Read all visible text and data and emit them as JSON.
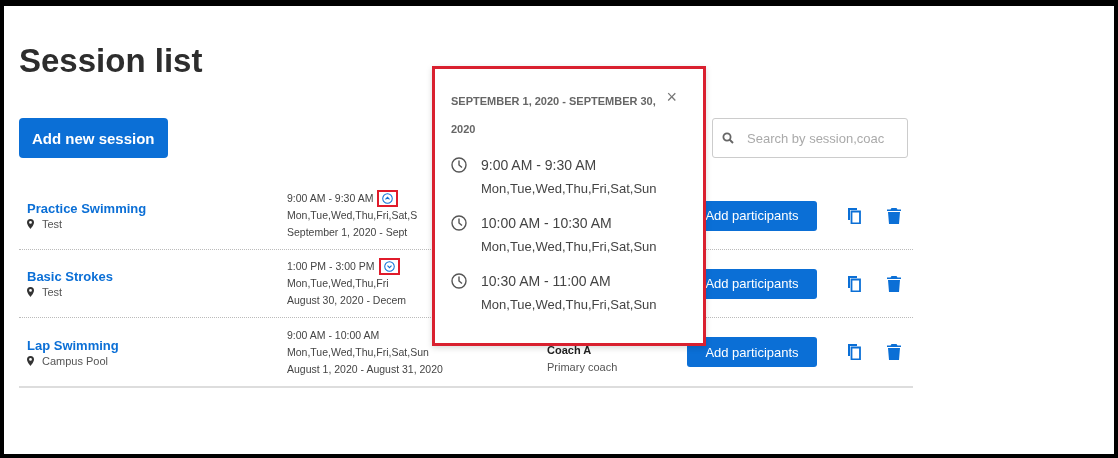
{
  "page": {
    "title": "Session list"
  },
  "add_button": "Add new session",
  "search": {
    "placeholder": "Search by session,coac"
  },
  "sessions": [
    {
      "name": "Practice Swimming",
      "location": "Test",
      "time": "9:00 AM - 9:30 AM",
      "days": "Mon,Tue,Wed,Thu,Fri,Sat,S",
      "dates": "September 1, 2020 - Sept",
      "toggle": {
        "expanded": true,
        "highlighted": true
      },
      "action": "Add participants"
    },
    {
      "name": "Basic Strokes",
      "location": "Test",
      "time": "1:00 PM - 3:00 PM",
      "days": "Mon,Tue,Wed,Thu,Fri",
      "dates": "August 30, 2020 - Decem",
      "toggle": {
        "expanded": false,
        "highlighted": true
      },
      "action": "Add participants"
    },
    {
      "name": "Lap Swimming",
      "location": "Campus Pool",
      "time": "9:00 AM - 10:00 AM",
      "days": "Mon,Tue,Wed,Thu,Fri,Sat,Sun",
      "dates": "August 1, 2020 - August 31, 2020",
      "coach": {
        "name": "Coach A",
        "role": "Primary coach"
      },
      "action": "Add participants"
    }
  ],
  "popover": {
    "title": "SEPTEMBER 1, 2020 - SEPTEMBER 30, 2020",
    "close": "×",
    "highlighted": true,
    "slots": [
      {
        "time": "9:00 AM - 9:30 AM",
        "days": "Mon,Tue,Wed,Thu,Fri,Sat,Sun"
      },
      {
        "time": "10:00 AM - 10:30 AM",
        "days": "Mon,Tue,Wed,Thu,Fri,Sat,Sun"
      },
      {
        "time": "10:30 AM - 11:00 AM",
        "days": "Mon,Tue,Wed,Thu,Fri,Sat,Sun"
      }
    ]
  }
}
